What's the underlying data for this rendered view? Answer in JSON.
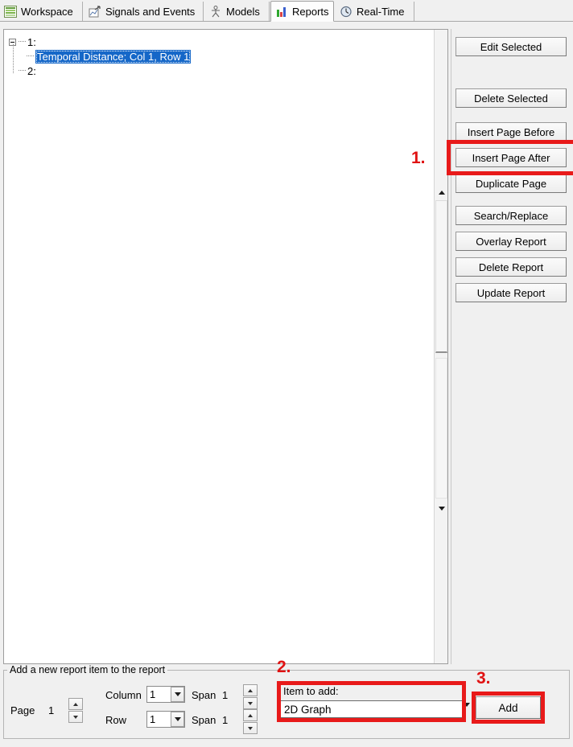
{
  "tabs": [
    {
      "label": "Workspace",
      "icon": "workspace-stripes-icon",
      "active": false
    },
    {
      "label": "Signals and Events",
      "icon": "signal-page-icon",
      "active": false
    },
    {
      "label": "Models",
      "icon": "stick-figure-icon",
      "active": false
    },
    {
      "label": "Reports",
      "icon": "bar-chart-icon",
      "active": true
    },
    {
      "label": "Real-Time",
      "icon": "clock-gauge-icon",
      "active": false
    }
  ],
  "tree": {
    "page1_label": "1:",
    "page1_child_label": "Temporal Distance; Col 1, Row 1",
    "page2_label": "2:"
  },
  "buttons": [
    {
      "label": "Edit Selected"
    },
    {
      "label": "Delete Selected"
    },
    {
      "label": "Insert Page Before"
    },
    {
      "label": "Insert Page After"
    },
    {
      "label": "Duplicate Page"
    },
    {
      "label": "Search/Replace"
    },
    {
      "label": "Overlay Report"
    },
    {
      "label": "Delete Report"
    },
    {
      "label": "Update Report"
    }
  ],
  "bottom": {
    "group_title": "Add a new report item to the report",
    "page_label": "Page",
    "page_value": "1",
    "column_label": "Column",
    "column_value": "1",
    "column_span_label": "Span",
    "column_span_value": "1",
    "row_label": "Row",
    "row_value": "1",
    "row_span_label": "Span",
    "row_span_value": "1",
    "item_to_add_label": "Item to add:",
    "item_to_add_value": "2D Graph",
    "add_button_label": "Add"
  },
  "annotations": {
    "step1": "1.",
    "step2": "2.",
    "step3": "3.",
    "color": "#e81a1a"
  }
}
